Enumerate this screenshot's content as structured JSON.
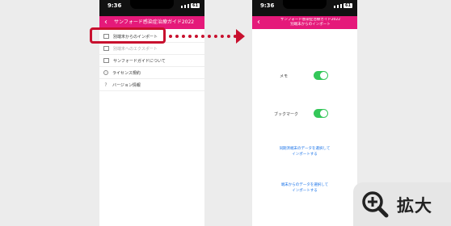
{
  "colors": {
    "brand": "#e5197a",
    "highlight": "#c8102e",
    "toggle_on": "#34c759",
    "link": "#1a73e8"
  },
  "left_phone": {
    "status": {
      "time": "9:36",
      "battery": "61"
    },
    "navbar": {
      "back": "‹",
      "title": "サンフォード感染症治療ガイド2022"
    },
    "menu": [
      {
        "icon": "file-import-icon",
        "label": "別端末からのインポート"
      },
      {
        "icon": "file-export-icon",
        "label": "別端末へのエクスポート"
      },
      {
        "icon": "book-icon",
        "label": "サンフォードガイドについて"
      },
      {
        "icon": "info-icon",
        "label": "ライセンス規約"
      },
      {
        "icon": "question-icon",
        "label": "バージョン情報"
      }
    ]
  },
  "right_phone": {
    "status": {
      "time": "9:36",
      "battery": "61"
    },
    "navbar": {
      "back": "‹",
      "title_line1": "サンフォード感染症治療ガイド2022",
      "title_line2": "別端末からのインポート"
    },
    "toggles": [
      {
        "label": "メモ",
        "on": true
      },
      {
        "label": "ブックマーク",
        "on": true
      }
    ],
    "links": [
      {
        "line1": "同期済端末のデータを選択して",
        "line2": "インポートする"
      },
      {
        "line1": "端末からのデータを選択して",
        "line2": "インポートする"
      }
    ]
  },
  "zoom": {
    "icon": "zoom-in-icon",
    "label": "拡大"
  }
}
